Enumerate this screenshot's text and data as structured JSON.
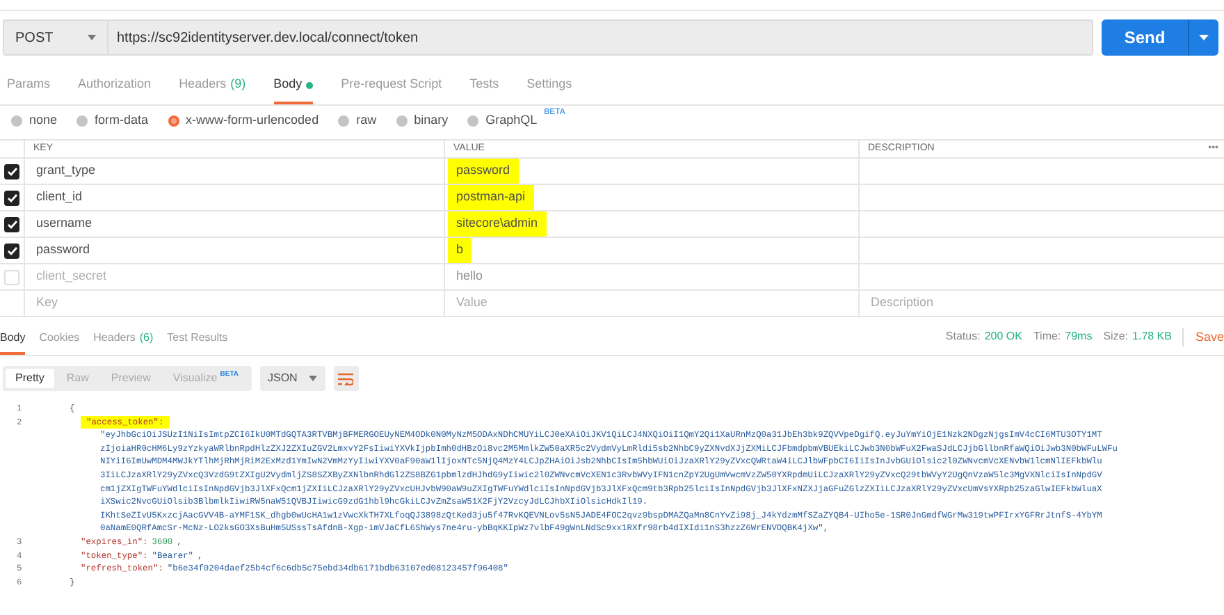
{
  "request": {
    "method": "POST",
    "url": "https://sc92identityserver.dev.local/connect/token",
    "send": "Send"
  },
  "request_tabs": [
    {
      "label": "Params",
      "selected": false
    },
    {
      "label": "Authorization",
      "selected": false
    },
    {
      "label": "Headers",
      "count": "(9)",
      "selected": false
    },
    {
      "label": "Body",
      "dot": true,
      "selected": true
    },
    {
      "label": "Pre-request Script",
      "selected": false
    },
    {
      "label": "Tests",
      "selected": false
    },
    {
      "label": "Settings",
      "selected": false
    }
  ],
  "body_types": [
    {
      "label": "none",
      "selected": false
    },
    {
      "label": "form-data",
      "selected": false
    },
    {
      "label": "x-www-form-urlencoded",
      "selected": true
    },
    {
      "label": "raw",
      "selected": false
    },
    {
      "label": "binary",
      "selected": false
    },
    {
      "label": "GraphQL",
      "badge": "BETA",
      "selected": false
    }
  ],
  "params_table": {
    "columns": [
      "KEY",
      "VALUE",
      "DESCRIPTION"
    ],
    "menu": "•••",
    "rows": [
      {
        "key": "grant_type",
        "value": "password",
        "checked": true,
        "highlighted": true
      },
      {
        "key": "client_id",
        "value": "postman-api",
        "checked": true,
        "highlighted": true
      },
      {
        "key": "username",
        "value": "sitecore\\admin",
        "checked": true,
        "highlighted": true
      },
      {
        "key": "password",
        "value": "b",
        "checked": true,
        "highlighted": true
      },
      {
        "key": "client_secret",
        "value": "hello",
        "checked": false,
        "highlighted": false
      }
    ],
    "new_row": {
      "key_placeholder": "Key",
      "value_placeholder": "Value",
      "description_placeholder": "Description"
    }
  },
  "response": {
    "tabs": [
      {
        "label": "Body",
        "selected": true
      },
      {
        "label": "Cookies",
        "selected": false
      },
      {
        "label": "Headers",
        "count": "(6)",
        "selected": false
      },
      {
        "label": "Test Results",
        "selected": false
      }
    ],
    "stats": [
      {
        "label": "Status:",
        "value": "200 OK"
      },
      {
        "label": "Time:",
        "value": "79ms"
      },
      {
        "label": "Size:",
        "value": "1.78 KB"
      }
    ],
    "save": "Save",
    "view_modes": [
      {
        "label": "Pretty",
        "selected": true
      },
      {
        "label": "Raw",
        "selected": false
      },
      {
        "label": "Preview",
        "selected": false
      },
      {
        "label": "Visualize",
        "badge": "BETA",
        "selected": false
      }
    ],
    "format": "JSON",
    "lines": [
      {
        "number": "1",
        "parts": [
          {
            "kind": "punct",
            "text": "{"
          }
        ]
      },
      {
        "number": "2",
        "parts": [
          {
            "kind": "key",
            "text": "\"access_token\":",
            "highlighted": true
          }
        ]
      },
      {
        "parts": [
          {
            "kind": "string",
            "text": "\"eyJhbGciOiJSUzI1NiIsImtpZCI6IkU0MTdGQTA3RTVBMjBFMERGOEUyNEM4ODk0N0MyNzM5ODAxNDhCMUYiLCJ0eXAiOiJKV1QiLCJ4NXQiOiI1QmY2Qi1XaURnMzQ0a31JbEh3bk9ZQVVpeDgifQ.eyJuYmYiOjE1Nzk2NDgzNjgsImV4cCI6MTU3OTY1MT"
          }
        ]
      },
      {
        "parts": [
          {
            "kind": "string",
            "text": "zIjoiaHR0cHM6Ly9zYzkyaWRlbnRpdHlzZXJ2ZXIuZGV2LmxvY2FsIiwiYXVkIjpbImh0dHBzOi8vc2M5MmlkZW50aXR5c2VydmVyLmRldi5sb2NhbC9yZXNvdXJjZXMiLCJFbmdpbmVBUEkiLCJwb3N0bWFuX2FwaSJdLCJjbGllbnRfaWQiOiJwb3N0bWFuLWFu"
          }
        ]
      },
      {
        "parts": [
          {
            "kind": "string",
            "text": "NIYiI6ImUwMDM4MWJkYTlhMjRhMjRiM2ExMzd1YmIwN2VmMzYyIiwiYXV0aF90aW1lIjoxNTc5NjQ4MzY4LCJpZHAiOiJsb2NhbCIsIm5hbWUiOiJzaXRlY29yZVxcQWRtaW4iLCJlbWFpbCI6IiIsInJvbGUiOlsic2l0ZWNvcmVcXENvbW1lcmNlIEFkbWlu"
          }
        ]
      },
      {
        "parts": [
          {
            "kind": "string",
            "text": "3IiLCJzaXRlY29yZVxcQ3VzdG9tZXIgU2VydmljZS8SZXByZXNlbnRhdGl2ZS8BZG1pbmlzdHJhdG9yIiwic2l0ZWNvcmVcXEN1c3RvbWVyIFN1cnZpY2UgUmVwcmVzZW50YXRpdmUiLCJzaXRlY29yZVxcQ29tbWVyY2UgQnVzaW5lc3MgVXNlciIsInNpdGV"
          }
        ]
      },
      {
        "parts": [
          {
            "kind": "string",
            "text": "cm1jZXIgTWFuYWdlciIsInNpdGVjb3JlXFxQcm1jZXIiLCJzaXRlY29yZVxcUHJvbW90aW9uZXIgTWFuYWdlciIsInNpdGVjb3JlXFxQcm9tb3Rpb25lciIsInNpdGVjb3JlXFxNZXJjaGFuZGlzZXIiLCJzaXRlY29yZVxcUmVsYXRpb25zaGlwIEFkbWluaX"
          }
        ]
      },
      {
        "parts": [
          {
            "kind": "string",
            "text": "iXSwic2NvcGUiOlsib3BlbmlkIiwiRW5naW51QVBJIiwicG9zdG1hbl9hcGkiLCJvZmZsaW51X2FjY2VzcyJdLCJhbXIiOlsicHdkIl19."
          }
        ]
      },
      {
        "parts": [
          {
            "kind": "string",
            "text": "IKhtSeZIvU5KxzcjAacGVV4B-aYMF1SK_dhgb0wUcHA1w1zVwcXkTH7XLfoqQJ3898zQtKed3ju5f47RvKQEVNLov5sN5JADE4FOC2qvz9bspDMAZQaMn8CnYvZi98j_J4kYdzmMfSZaZYQB4-UIho5e-1SR0JnGmdfWGrMw319twPFIrxYGFRrJtnfS-4YbYM"
          }
        ]
      },
      {
        "parts": [
          {
            "kind": "string",
            "text": "0aNamE0QRfAmcSr-McNz-LO2ksGO3XsBuHm5USssTsAfdnB-Xgp-imVJaCfL6ShWys7ne4ru-ybBqKKIpWz7vlbF49gWnLNdSc9xx1RXfr98rb4dIXIdi1nS3hzzZ6WrENVOQBK4jXw\","
          }
        ]
      },
      {
        "number": "3",
        "parts": [
          {
            "kind": "key",
            "text": "\"expires_in\":"
          },
          {
            "kind": "number",
            "text": "3600"
          },
          {
            "kind": "punct",
            "text": ","
          }
        ]
      },
      {
        "number": "4",
        "parts": [
          {
            "kind": "key",
            "text": "\"token_type\":"
          },
          {
            "kind": "string",
            "text": "\"Bearer\""
          },
          {
            "kind": "punct",
            "text": ","
          }
        ]
      },
      {
        "number": "5",
        "parts": [
          {
            "kind": "key",
            "text": "\"refresh_token\":"
          },
          {
            "kind": "string",
            "text": "\"b6e34f0204daef25b4cf6c6db5c75ebd34db6171bdb63107ed08123457f96408\""
          }
        ]
      },
      {
        "number": "6",
        "parts": [
          {
            "kind": "punct",
            "text": "}"
          }
        ]
      }
    ]
  }
}
